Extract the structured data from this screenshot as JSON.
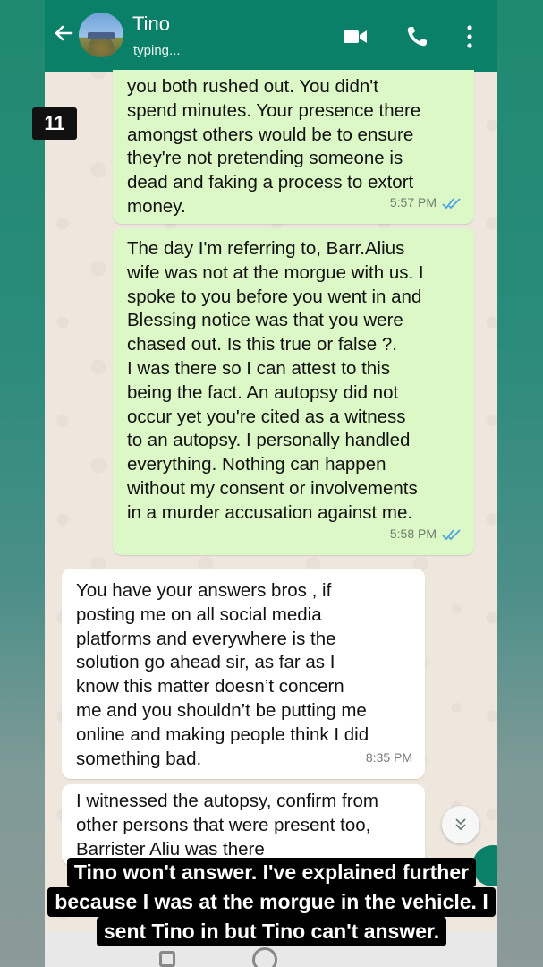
{
  "chat": {
    "contact_name": "Tino",
    "status": "typing..."
  },
  "badge": "11",
  "messages": [
    {
      "direction": "outgoing",
      "lines": [
        "you both rushed out. You didn't",
        "spend minutes. Your presence there",
        "amongst others would be to ensure",
        "they're not pretending someone is",
        "dead and faking a process to extort",
        "money."
      ],
      "time": "5:57 PM",
      "read": true
    },
    {
      "direction": "outgoing",
      "lines": [
        "The day I'm referring to, Barr.Alius",
        "wife was not at the morgue with us. I",
        "spoke to you before you went in and",
        "Blessing notice was that you were",
        "chased out. Is this true or false ?.",
        "I was there so I can attest to this",
        "being the fact. An autopsy did not",
        "occur yet you're cited as a witness",
        "to an autopsy. I personally handled",
        "everything. Nothing can happen",
        "without my consent or involvements",
        "in a murder accusation against me."
      ],
      "time": "5:58 PM",
      "read": true
    },
    {
      "direction": "incoming",
      "lines": [
        "You have your answers bros , if",
        "posting me on all social media",
        "platforms and everywhere is the",
        "solution go ahead sir, as far as I",
        "know this matter doesn’t concern",
        "me and you shouldn’t be putting me",
        "online and making people think I did",
        "something bad."
      ],
      "time": "8:35 PM"
    },
    {
      "direction": "incoming",
      "lines": [
        "I witnessed the autopsy, confirm from",
        "other persons that were present too,",
        "Barrister Aliu was there"
      ]
    }
  ],
  "caption": {
    "lines": [
      "Tino won't answer. I've explained further",
      "because I was at the morgue in the vehicle. I",
      "sent Tino in but Tino can't answer."
    ]
  },
  "colors": {
    "header": "#0b8068",
    "outgoing_bubble": "#dcf8c6",
    "incoming_bubble": "#ffffff",
    "read_ticks": "#4fa3e0"
  },
  "icons": [
    "back-arrow-icon",
    "video-call-icon",
    "phone-call-icon",
    "more-options-icon",
    "read-receipt-icon",
    "scroll-down-icon"
  ]
}
